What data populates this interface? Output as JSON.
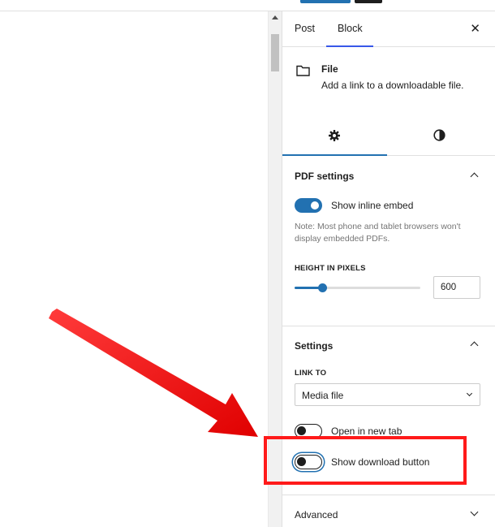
{
  "tabs": {
    "post": "Post",
    "block": "Block"
  },
  "block_card": {
    "title": "File",
    "description": "Add a link to a downloadable file."
  },
  "pdf_settings": {
    "title": "PDF settings",
    "inline_embed_label": "Show inline embed",
    "inline_embed_on": true,
    "note": "Note: Most phone and tablet browsers won't display embedded PDFs.",
    "height_label": "HEIGHT IN PIXELS",
    "height_value": "600",
    "height_slider_fraction": 0.22
  },
  "settings": {
    "title": "Settings",
    "link_to_label": "LINK TO",
    "link_to_value": "Media file",
    "open_new_tab_label": "Open in new tab",
    "open_new_tab_on": false,
    "download_button_label": "Show download button",
    "download_button_on": false
  },
  "advanced": {
    "title": "Advanced"
  },
  "colors": {
    "accent": "#2271b1",
    "annotation": "#ff1a1a"
  }
}
